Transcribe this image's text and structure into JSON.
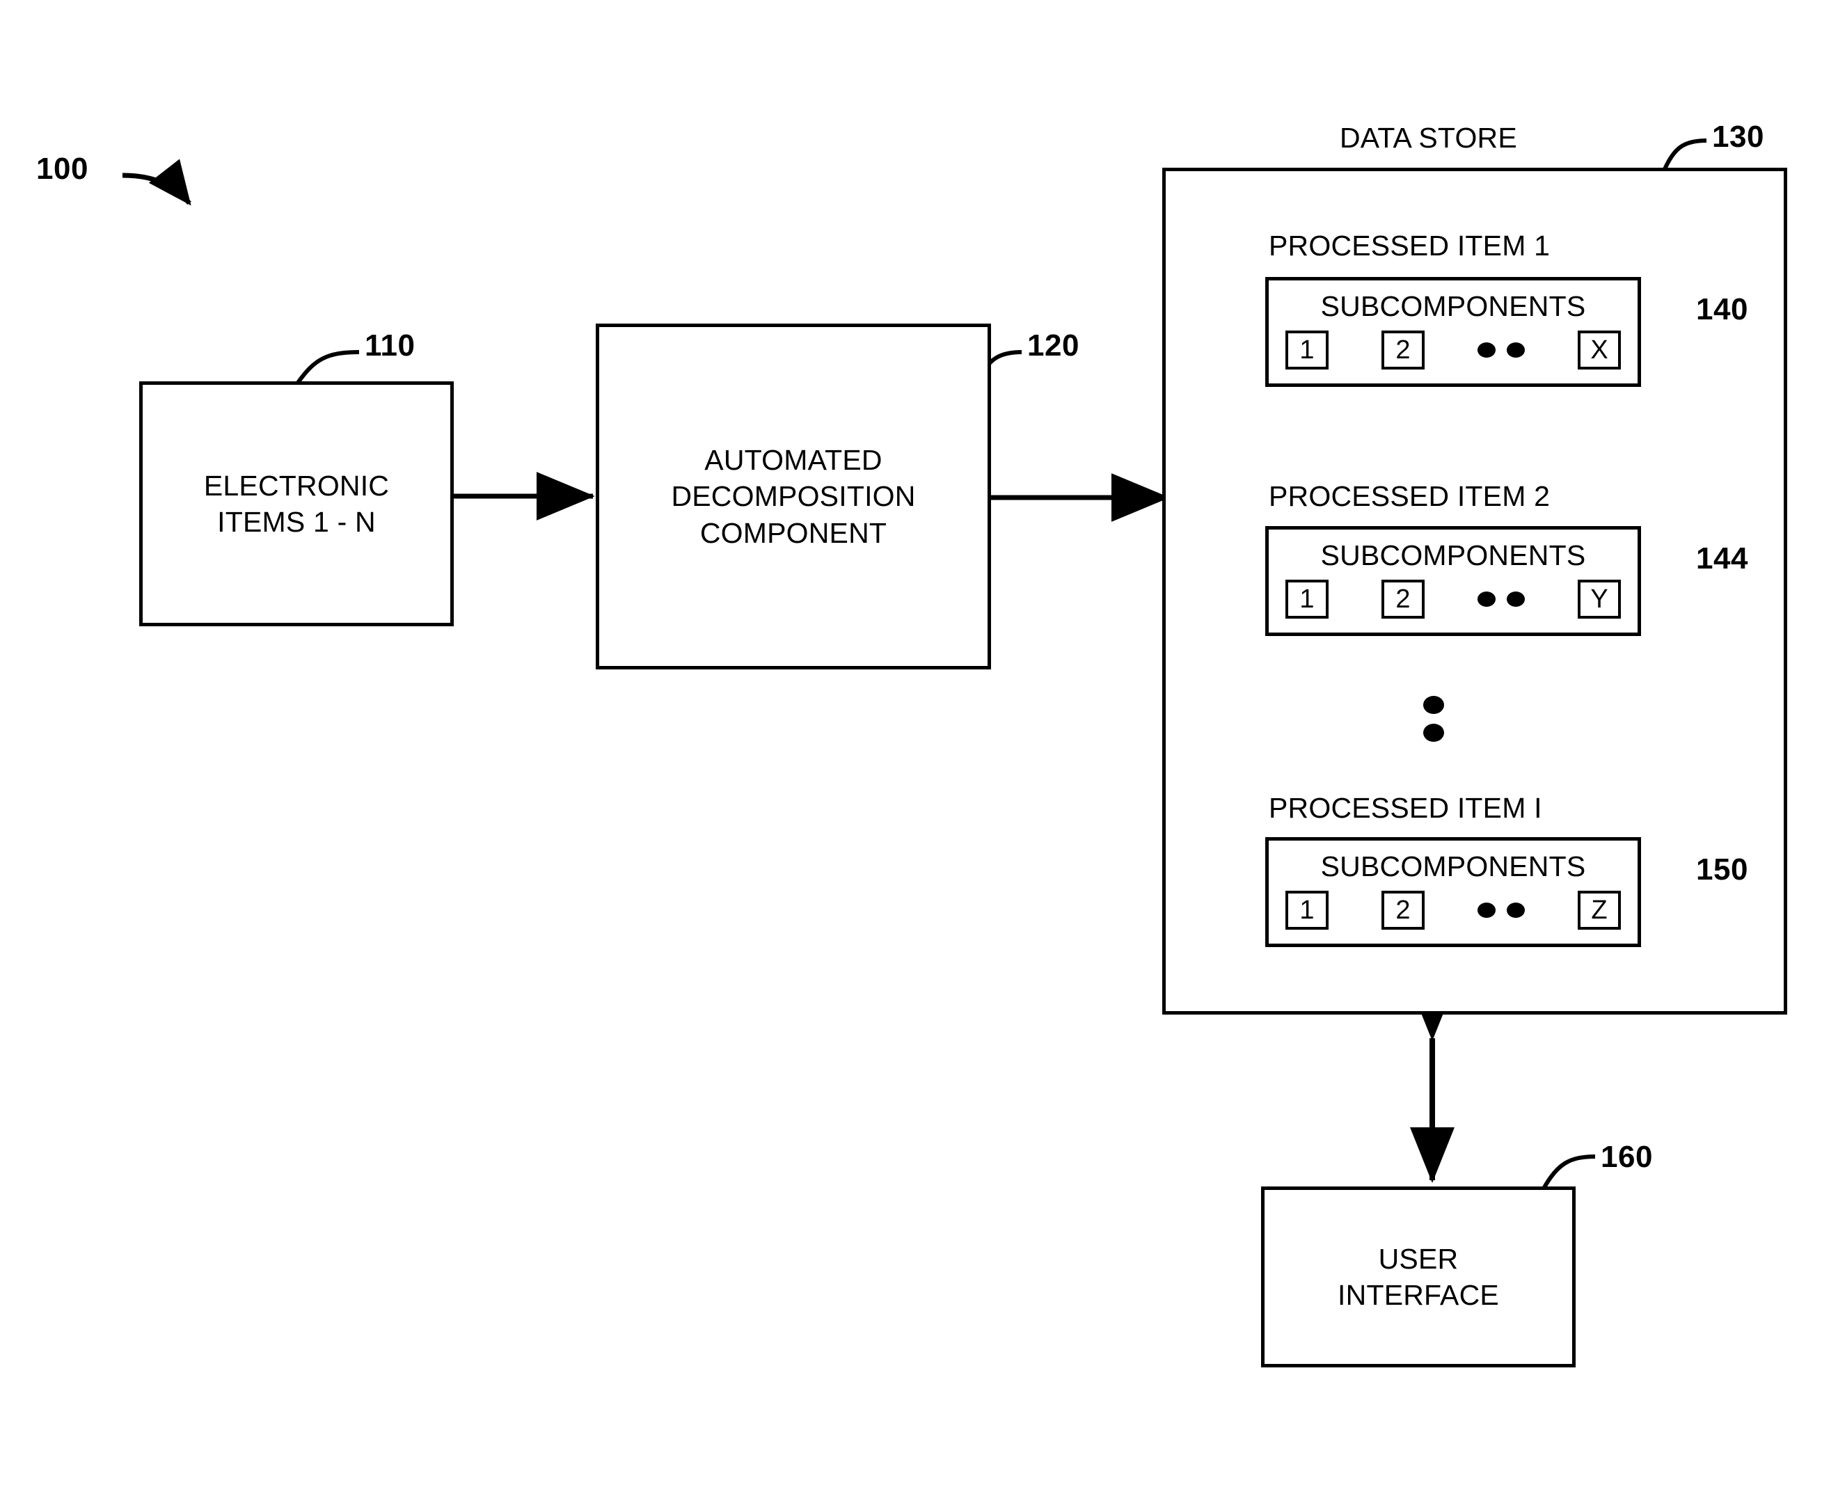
{
  "figure": {
    "id": "100",
    "title_numeral": "100"
  },
  "nodes": {
    "electronic_items": {
      "label": "ELECTRONIC\nITEMS 1 - N",
      "ref": "110"
    },
    "decomposition": {
      "label": "AUTOMATED\nDECOMPOSITION\nCOMPONENT",
      "ref": "120"
    },
    "data_store": {
      "title": "DATA STORE",
      "ref": "130"
    },
    "user_interface": {
      "label": "USER\nINTERFACE",
      "ref": "160"
    }
  },
  "processed_items": [
    {
      "caption": "PROCESSED ITEM 1",
      "subcomponents_title": "SUBCOMPONENTS",
      "chips": [
        "1",
        "2",
        "X"
      ],
      "ellipsis": "dots",
      "ref": "140"
    },
    {
      "caption": "PROCESSED ITEM 2",
      "subcomponents_title": "SUBCOMPONENTS",
      "chips": [
        "1",
        "2",
        "Y"
      ],
      "ellipsis": "dots",
      "ref": "144"
    },
    {
      "caption": "PROCESSED ITEM I",
      "subcomponents_title": "SUBCOMPONENTS",
      "chips": [
        "1",
        "2",
        "Z"
      ],
      "ellipsis": "dots",
      "ref": "150"
    }
  ],
  "connectors": [
    {
      "name": "items-to-decomposition",
      "type": "arrow-right"
    },
    {
      "name": "decomposition-to-datastore",
      "type": "arrow-right"
    },
    {
      "name": "datastore-to-ui",
      "type": "arrow-double-vertical"
    },
    {
      "name": "figure-pointer",
      "type": "curved-arrow"
    }
  ],
  "colors": {
    "ink": "#000000",
    "paper": "#ffffff"
  }
}
